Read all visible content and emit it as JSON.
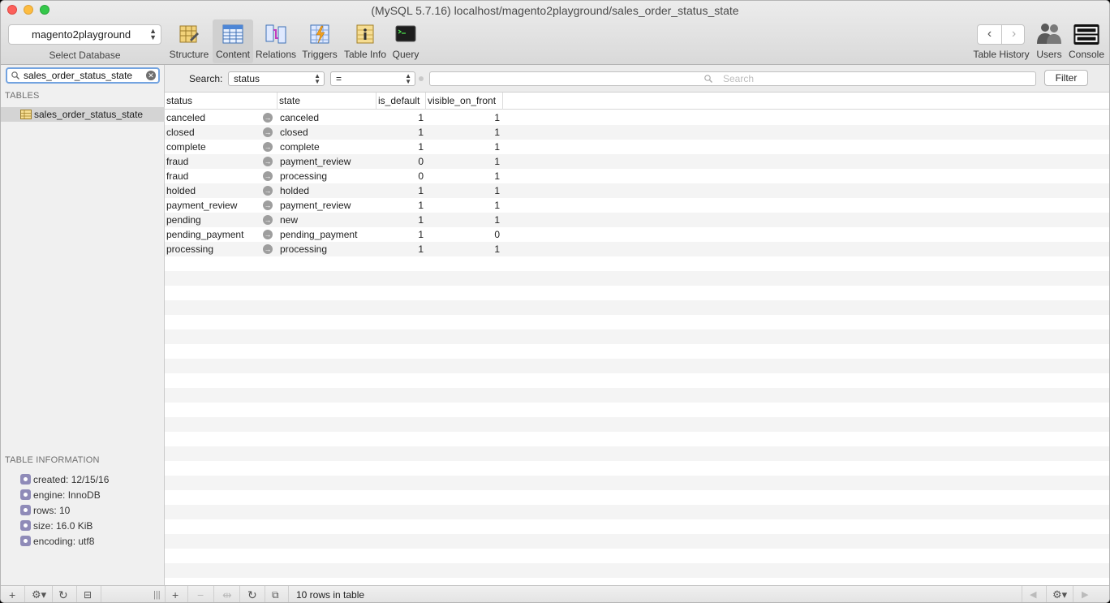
{
  "window": {
    "title": "(MySQL 5.7.16) localhost/magento2playground/sales_order_status_state"
  },
  "toolbar": {
    "database": "magento2playground",
    "select_database_label": "Select Database",
    "tools": [
      {
        "label": "Structure",
        "icon": "structure-icon"
      },
      {
        "label": "Content",
        "icon": "content-icon",
        "active": true
      },
      {
        "label": "Relations",
        "icon": "relations-icon"
      },
      {
        "label": "Triggers",
        "icon": "triggers-icon"
      },
      {
        "label": "Table Info",
        "icon": "table-info-icon"
      },
      {
        "label": "Query",
        "icon": "query-icon"
      }
    ],
    "right": [
      {
        "label": "Table History"
      },
      {
        "label": "Users"
      },
      {
        "label": "Console"
      }
    ]
  },
  "sidebar": {
    "table_filter_value": "sales_order_status_state",
    "tables_header": "TABLES",
    "tables": [
      "sales_order_status_state"
    ],
    "info_header": "TABLE INFORMATION",
    "info": [
      "created: 12/15/16",
      "engine: InnoDB",
      "rows: 10",
      "size: 16.0 KiB",
      "encoding: utf8"
    ]
  },
  "filter": {
    "label": "Search:",
    "field": "status",
    "operator": "=",
    "placeholder": "Search",
    "button": "Filter"
  },
  "grid": {
    "columns": [
      "status",
      "state",
      "is_default",
      "visible_on_front"
    ],
    "rows": [
      [
        "canceled",
        "canceled",
        "1",
        "1"
      ],
      [
        "closed",
        "closed",
        "1",
        "1"
      ],
      [
        "complete",
        "complete",
        "1",
        "1"
      ],
      [
        "fraud",
        "payment_review",
        "0",
        "1"
      ],
      [
        "fraud",
        "processing",
        "0",
        "1"
      ],
      [
        "holded",
        "holded",
        "1",
        "1"
      ],
      [
        "payment_review",
        "payment_review",
        "1",
        "1"
      ],
      [
        "pending",
        "new",
        "1",
        "1"
      ],
      [
        "pending_payment",
        "pending_payment",
        "1",
        "0"
      ],
      [
        "processing",
        "processing",
        "1",
        "1"
      ]
    ]
  },
  "status_bar": {
    "text": "10 rows in table"
  },
  "colors": {
    "stripe": "#f4f4f4",
    "accent": "#73a3e0",
    "selected": "#d4d4d4"
  }
}
